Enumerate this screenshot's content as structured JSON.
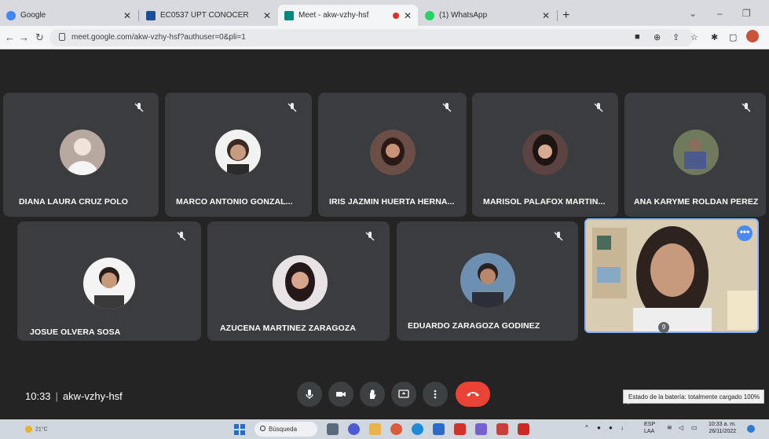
{
  "browser": {
    "tabs": [
      {
        "label": "Google",
        "color": "#4285f4"
      },
      {
        "label": "EC0537 UPT CONOCER",
        "color": "#1a4e9a"
      },
      {
        "label": "Meet - akw-vzhy-hsf",
        "color": "#00897b"
      },
      {
        "label": "(1) WhatsApp",
        "color": "#25d366"
      }
    ],
    "url_host": "meet.google.com",
    "url_path": "/akw-vzhy-hsf?authuser=0&pli=1"
  },
  "meet": {
    "participants": [
      {
        "name": "DIANA LAURA CRUZ POLO",
        "avatar_color": "#b7a9a0"
      },
      {
        "name": "MARCO ANTONIO GONZAL...",
        "avatar_color": "#8c7a6a"
      },
      {
        "name": "IRIS JAZMIN HUERTA HERNA...",
        "avatar_color": "#6b4e45"
      },
      {
        "name": "MARISOL PALAFOX MARTIN...",
        "avatar_color": "#5a4340"
      },
      {
        "name": "ANA KARYME ROLDAN PEREZ",
        "avatar_color": "#6f7a5c"
      },
      {
        "name": "JOSUE OLVERA SOSA",
        "avatar_color": "#7c6a5d"
      },
      {
        "name": "AZUCENA MARTINEZ ZARAGOZA",
        "avatar_color": "#5a4a4a"
      },
      {
        "name": "EDUARDO ZARAGOZA GODINEZ",
        "avatar_color": "#4a4f5a"
      }
    ],
    "time": "10:33",
    "meeting_code": "akw-vzhy-hsf",
    "more_label": "•••",
    "people_badge": "9",
    "accent": "#8ab4f8",
    "hangup_color": "#ea4335"
  },
  "tooltip": "Estado de la batería: totalmente cargado 100%",
  "taskbar": {
    "weather": "21°C",
    "search_label": "Búsqueda",
    "lang_line1": "ESP",
    "lang_line2": "LAA",
    "time": "10:33 a. m.",
    "date": "26/11/2022"
  }
}
